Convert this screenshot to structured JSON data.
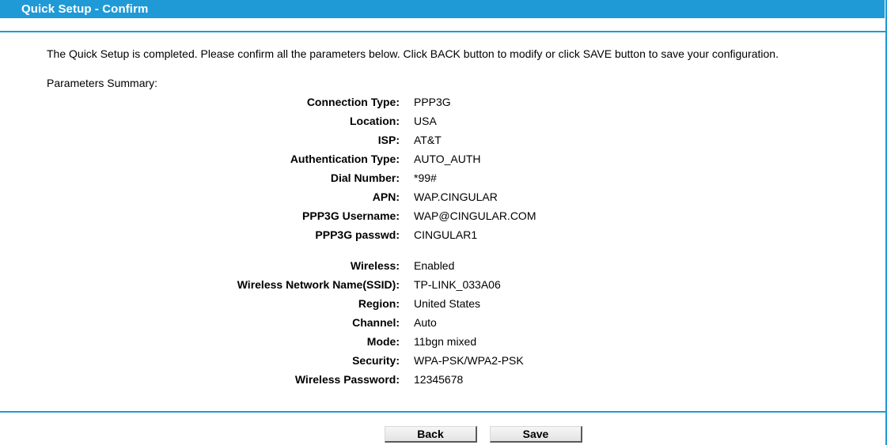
{
  "header": {
    "title": "Quick Setup - Confirm"
  },
  "intro_text": "The Quick Setup is completed. Please confirm all the parameters below. Click BACK button to modify or click SAVE button to save your configuration.",
  "summary_heading": "Parameters Summary:",
  "connection": [
    {
      "label": "Connection Type:",
      "value": "PPP3G"
    },
    {
      "label": "Location:",
      "value": "USA"
    },
    {
      "label": "ISP:",
      "value": "AT&T"
    },
    {
      "label": "Authentication Type:",
      "value": "AUTO_AUTH"
    },
    {
      "label": "Dial Number:",
      "value": "*99#"
    },
    {
      "label": "APN:",
      "value": "WAP.CINGULAR"
    },
    {
      "label": "PPP3G Username:",
      "value": "WAP@CINGULAR.COM"
    },
    {
      "label": "PPP3G passwd:",
      "value": "CINGULAR1"
    }
  ],
  "wireless": [
    {
      "label": "Wireless:",
      "value": "Enabled"
    },
    {
      "label": "Wireless Network Name(SSID):",
      "value": "TP-LINK_033A06"
    },
    {
      "label": "Region:",
      "value": "United States"
    },
    {
      "label": "Channel:",
      "value": "Auto"
    },
    {
      "label": "Mode:",
      "value": "11bgn mixed"
    },
    {
      "label": "Security:",
      "value": "WPA-PSK/WPA2-PSK"
    },
    {
      "label": "Wireless Password:",
      "value": "12345678"
    }
  ],
  "buttons": {
    "back_label": "Back",
    "save_label": "Save"
  },
  "colors": {
    "accent": "#1f9ad6",
    "header_text": "#ffffff"
  }
}
